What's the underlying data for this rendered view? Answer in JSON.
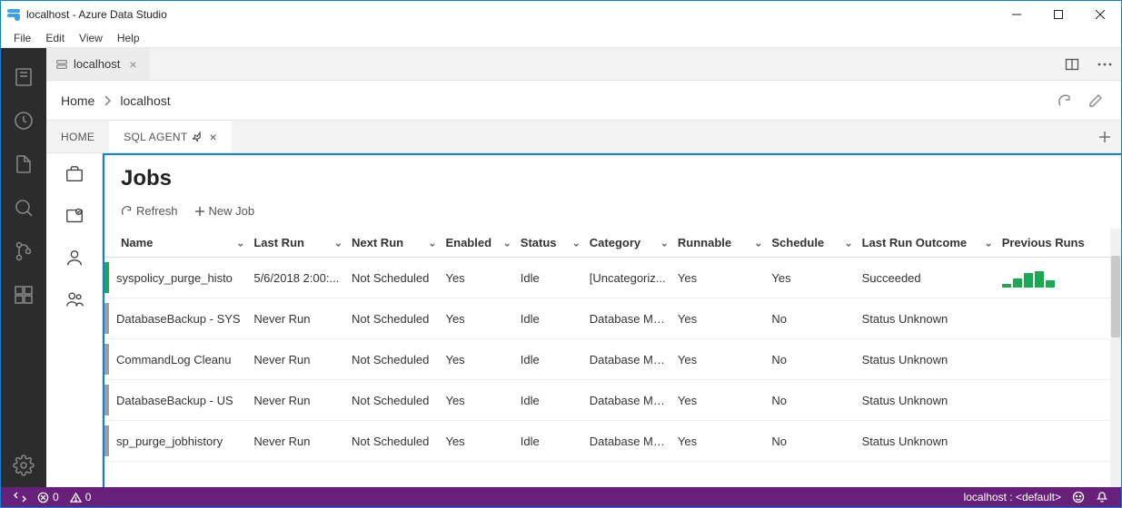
{
  "titlebar": {
    "title": "localhost - Azure Data Studio"
  },
  "menubar": {
    "items": [
      "File",
      "Edit",
      "View",
      "Help"
    ]
  },
  "tab": {
    "label": "localhost"
  },
  "breadcrumb": {
    "items": [
      "Home",
      "localhost"
    ]
  },
  "dash_tabs": {
    "home": "HOME",
    "sql_agent": "SQL AGENT"
  },
  "page": {
    "title": "Jobs"
  },
  "toolbar": {
    "refresh": "Refresh",
    "new_job": "New Job"
  },
  "columns": {
    "name": "Name",
    "last_run": "Last Run",
    "next_run": "Next Run",
    "enabled": "Enabled",
    "status": "Status",
    "category": "Category",
    "runnable": "Runnable",
    "schedule": "Schedule",
    "last_outcome": "Last Run Outcome",
    "prev_runs": "Previous Runs"
  },
  "rows": [
    {
      "name": "syspolicy_purge_histo",
      "last_run": "5/6/2018 2:00:...",
      "next_run": "Not Scheduled",
      "enabled": "Yes",
      "status": "Idle",
      "category": "[Uncategoriz...",
      "runnable": "Yes",
      "schedule": "Yes",
      "outcome": "Succeeded",
      "ok": true,
      "spark": [
        4,
        10,
        16,
        18,
        8
      ]
    },
    {
      "name": "DatabaseBackup - SYS",
      "last_run": "Never Run",
      "next_run": "Not Scheduled",
      "enabled": "Yes",
      "status": "Idle",
      "category": "Database Mai...",
      "runnable": "Yes",
      "schedule": "No",
      "outcome": "Status Unknown",
      "ok": false
    },
    {
      "name": "CommandLog Cleanu",
      "last_run": "Never Run",
      "next_run": "Not Scheduled",
      "enabled": "Yes",
      "status": "Idle",
      "category": "Database Mai...",
      "runnable": "Yes",
      "schedule": "No",
      "outcome": "Status Unknown",
      "ok": false
    },
    {
      "name": "DatabaseBackup - US",
      "last_run": "Never Run",
      "next_run": "Not Scheduled",
      "enabled": "Yes",
      "status": "Idle",
      "category": "Database Mai...",
      "runnable": "Yes",
      "schedule": "No",
      "outcome": "Status Unknown",
      "ok": false
    },
    {
      "name": "sp_purge_jobhistory",
      "last_run": "Never Run",
      "next_run": "Not Scheduled",
      "enabled": "Yes",
      "status": "Idle",
      "category": "Database Mai...",
      "runnable": "Yes",
      "schedule": "No",
      "outcome": "Status Unknown",
      "ok": false
    }
  ],
  "statusbar": {
    "errors": "0",
    "warnings": "0",
    "connection": "localhost : <default>"
  },
  "colors": {
    "accent": "#0a84d8",
    "purple": "#68217a",
    "green": "#1aaa55"
  }
}
